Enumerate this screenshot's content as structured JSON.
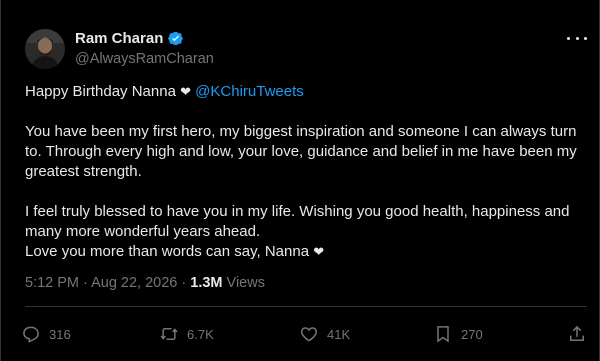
{
  "author": {
    "name": "Ram Charan",
    "handle": "@AlwaysRamCharan",
    "verified": true,
    "avatar_icon": "profile-photo"
  },
  "tweet": {
    "line1_text": "Happy Birthday Nanna ",
    "line1_heart": "❤",
    "mention": "@KChiruTweets",
    "para1": "You have been my first hero, my biggest inspiration and someone I can always turn to. Through every high and low, your love, guidance and belief in me have been my greatest strength.",
    "para2_line1": "I feel truly blessed to have you in my life. Wishing you good health, happiness and many more wonderful years ahead.",
    "para2_line2": "Love you more than words can say, Nanna ",
    "para2_heart": "❤"
  },
  "meta": {
    "time": "5:12 PM",
    "separator1": " · ",
    "date": "Aug 22, 2026",
    "separator2": " · ",
    "views_count": "1.3M",
    "views_label": " Views"
  },
  "actions": {
    "replies": "316",
    "reposts": "6.7K",
    "likes": "41K",
    "bookmarks": "270"
  },
  "colors": {
    "background": "#000000",
    "accent": "#1d9bf0",
    "secondary_text": "#71767b",
    "primary_text": "#e7e9ea"
  }
}
